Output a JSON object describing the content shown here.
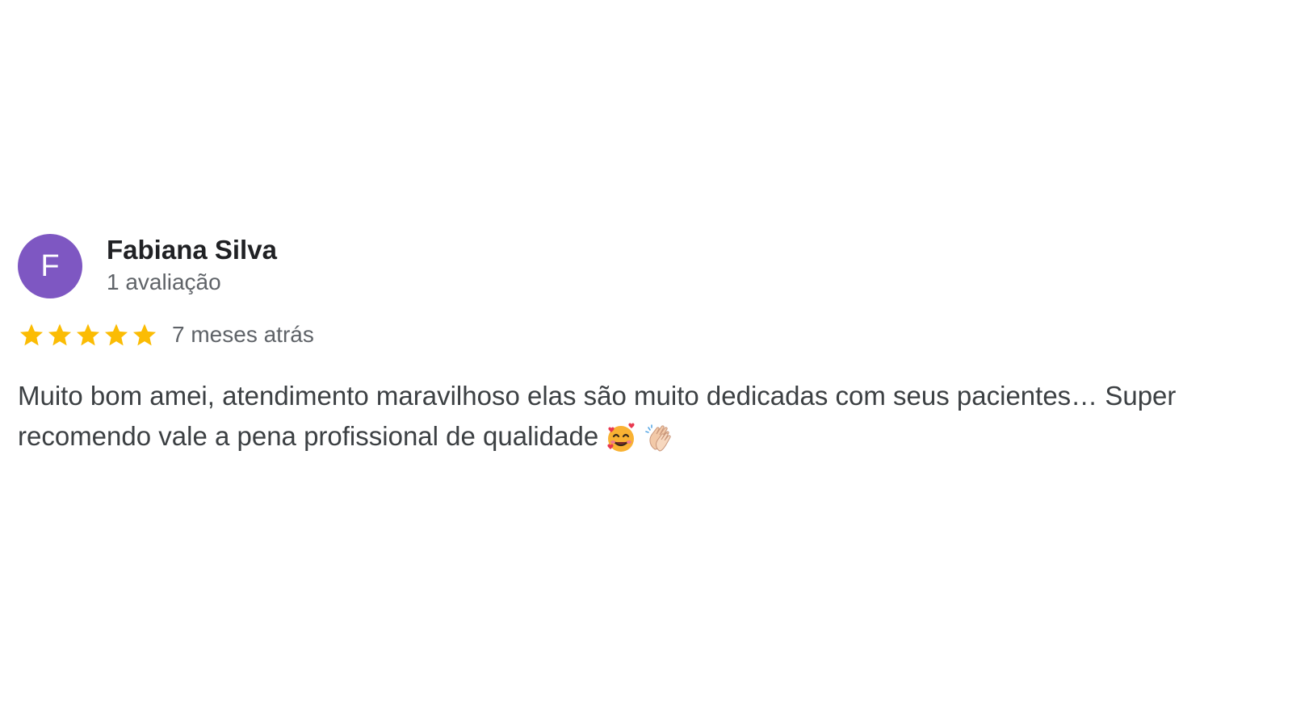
{
  "review": {
    "avatar": {
      "initial": "F",
      "color": "#7e57c2"
    },
    "author_name": "Fabiana Silva",
    "review_count": "1 avaliação",
    "rating": 5,
    "rating_max": 5,
    "star_color": "#fbbc04",
    "time_ago": "7 meses atrás",
    "text": "Muito bom amei, atendimento maravilhoso elas são muito dedicadas com seus pacientes… Super recomendo vale a pena profissional de qualidade",
    "emojis": [
      "smiling-face-with-hearts-icon",
      "clapping-hands-icon"
    ]
  }
}
